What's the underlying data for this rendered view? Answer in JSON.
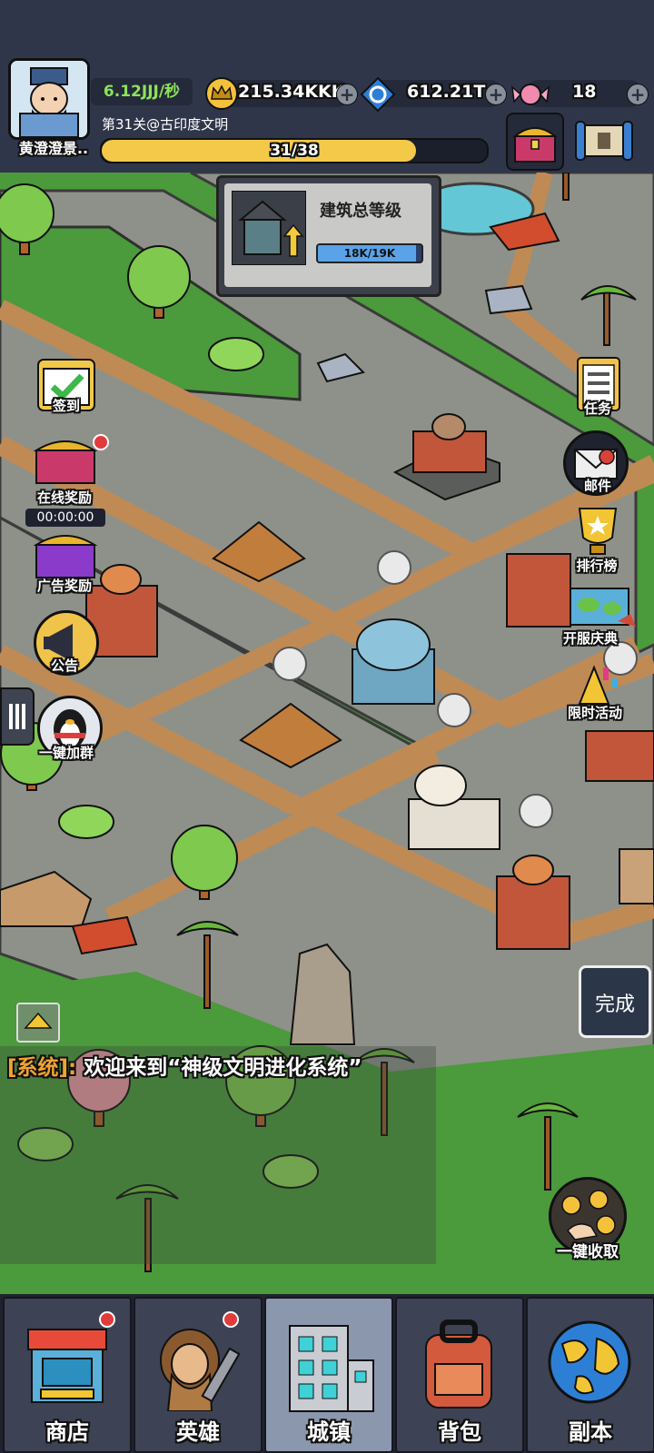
{
  "header": {
    "player_name": "黄澄澄景..",
    "income_rate": "6.12JJJ/秒",
    "crowns": "215.34KKK",
    "gems": "612.21T",
    "candy": "18",
    "level_label": "第31关@古印度文明",
    "level_progress": "31/38",
    "level_progress_fraction": 0.816
  },
  "building_panel": {
    "title": "建筑总等级",
    "progress": "18K/19K",
    "progress_fraction": 0.947
  },
  "left_buttons": {
    "checkin": "签到",
    "online_reward": "在线奖励",
    "online_timer": "00:00:00",
    "ad_reward": "广告奖励",
    "notice": "公告",
    "join_group": "一键加群"
  },
  "right_buttons": {
    "tasks": "任务",
    "mail": "邮件",
    "ranking": "排行榜",
    "server_celebration": "开服庆典",
    "limited_event": "限时活动",
    "complete": "完成",
    "collect_all": "一键收取"
  },
  "chat": {
    "sender": "[系统]:",
    "message": " 欢迎来到“神级文明进化系统”"
  },
  "nav": {
    "shop": "商店",
    "heroes": "英雄",
    "town": "城镇",
    "backpack": "背包",
    "dungeon": "副本"
  },
  "colors": {
    "background": "#2f3446",
    "grass": "#4b9a3c",
    "road": "#c08a55",
    "plaza": "#8c8f86",
    "progress": "#f4c94a",
    "income": "#8de35a",
    "system_chat": "#f0a330"
  }
}
